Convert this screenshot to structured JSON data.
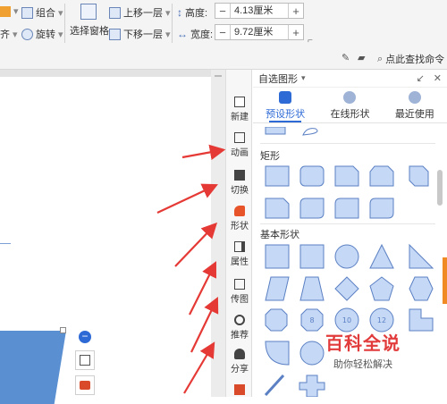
{
  "ribbon": {
    "group": "组合",
    "rotate": "旋转",
    "align_fragment": "齐",
    "selection_pane": "选择窗格",
    "bring_forward": "上移一层",
    "send_backward": "下移一层",
    "height_label": "高度:",
    "height_value": "4.13厘米",
    "width_label": "宽度:",
    "width_value": "9.72厘米",
    "search": "点此查找命令",
    "minus": "−",
    "plus": "+"
  },
  "sidebar": {
    "items": [
      {
        "label": "新建",
        "icon": "new-file-icon"
      },
      {
        "label": "动画",
        "icon": "animation-icon"
      },
      {
        "label": "切换",
        "icon": "transition-icon"
      },
      {
        "label": "形状",
        "icon": "shape-icon"
      },
      {
        "label": "属性",
        "icon": "properties-icon"
      },
      {
        "label": "传图",
        "icon": "upload-image-icon"
      },
      {
        "label": "推荐",
        "icon": "recommend-icon"
      },
      {
        "label": "分享",
        "icon": "share-icon"
      }
    ]
  },
  "panel": {
    "title": "自选图形",
    "tabs": [
      {
        "label": "预设形状",
        "active": true
      },
      {
        "label": "在线形状",
        "active": false
      },
      {
        "label": "最近使用",
        "active": false
      }
    ],
    "sections": [
      {
        "title": "矩形"
      },
      {
        "title": "基本形状"
      }
    ],
    "shape_labels": {
      "octagon": "8",
      "decagon": "10",
      "dodecagon": "12"
    }
  },
  "watermark": {
    "title": "百科全说",
    "subtitle": "助你轻松解决"
  },
  "colors": {
    "accent": "#2d6ad6",
    "shape_fill": "#c5d8f5",
    "shape_stroke": "#5b80c4",
    "arrow": "#e53935",
    "watermark_title": "#e23b3b"
  }
}
